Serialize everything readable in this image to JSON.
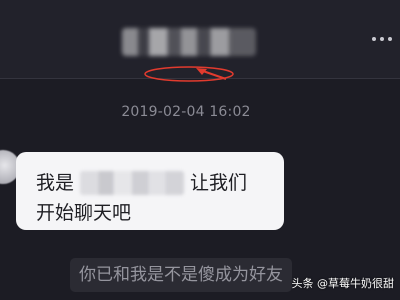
{
  "header": {
    "contact_name_visible": false,
    "more_icon": "more-horizontal-icon"
  },
  "chat": {
    "timestamp": "2019-02-04 16:02",
    "incoming_message": {
      "prefix": "我是",
      "suffix": "让我们",
      "line2": "开始聊天吧"
    },
    "system_message": "你已和我是不是傻成为好友"
  },
  "watermark": {
    "text": "头条 @草莓牛奶很甜"
  },
  "colors": {
    "background": "#1c1c24",
    "bubble": "#f5f5f7",
    "annotation": "#e23b2e"
  }
}
